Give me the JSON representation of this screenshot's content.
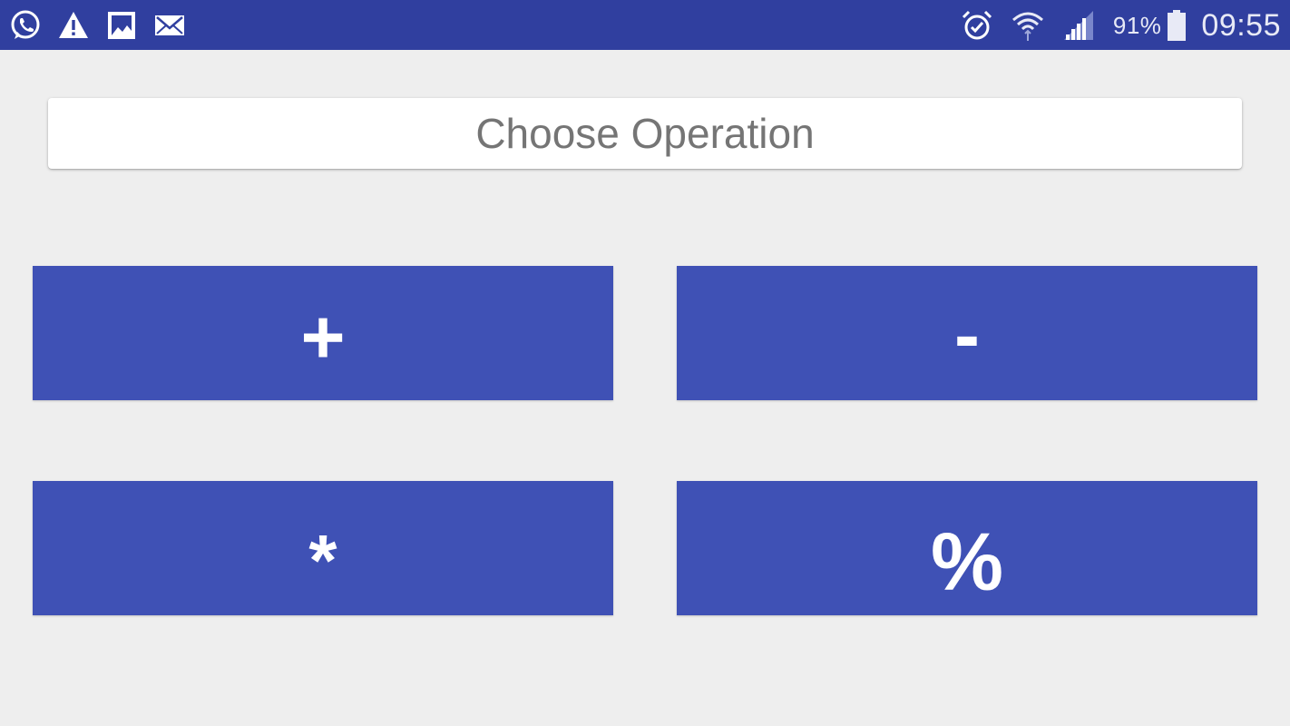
{
  "status_bar": {
    "left_icons": [
      "whatsapp-icon",
      "warning-icon",
      "gallery-icon",
      "mail-icon"
    ],
    "right_icons": [
      "alarm-icon",
      "wifi-icon",
      "signal-icon"
    ],
    "battery_text": "91%",
    "battery_level": 0.91,
    "time": "09:55",
    "color": "#303f9f"
  },
  "header": {
    "title": "Choose Operation"
  },
  "operations": {
    "plus": "+",
    "minus": "-",
    "multiply": "*",
    "modulo": "%"
  },
  "colors": {
    "primary": "#3f51b5",
    "primary_dark": "#303f9f",
    "background": "#eeeeee",
    "title_text": "#757575"
  }
}
